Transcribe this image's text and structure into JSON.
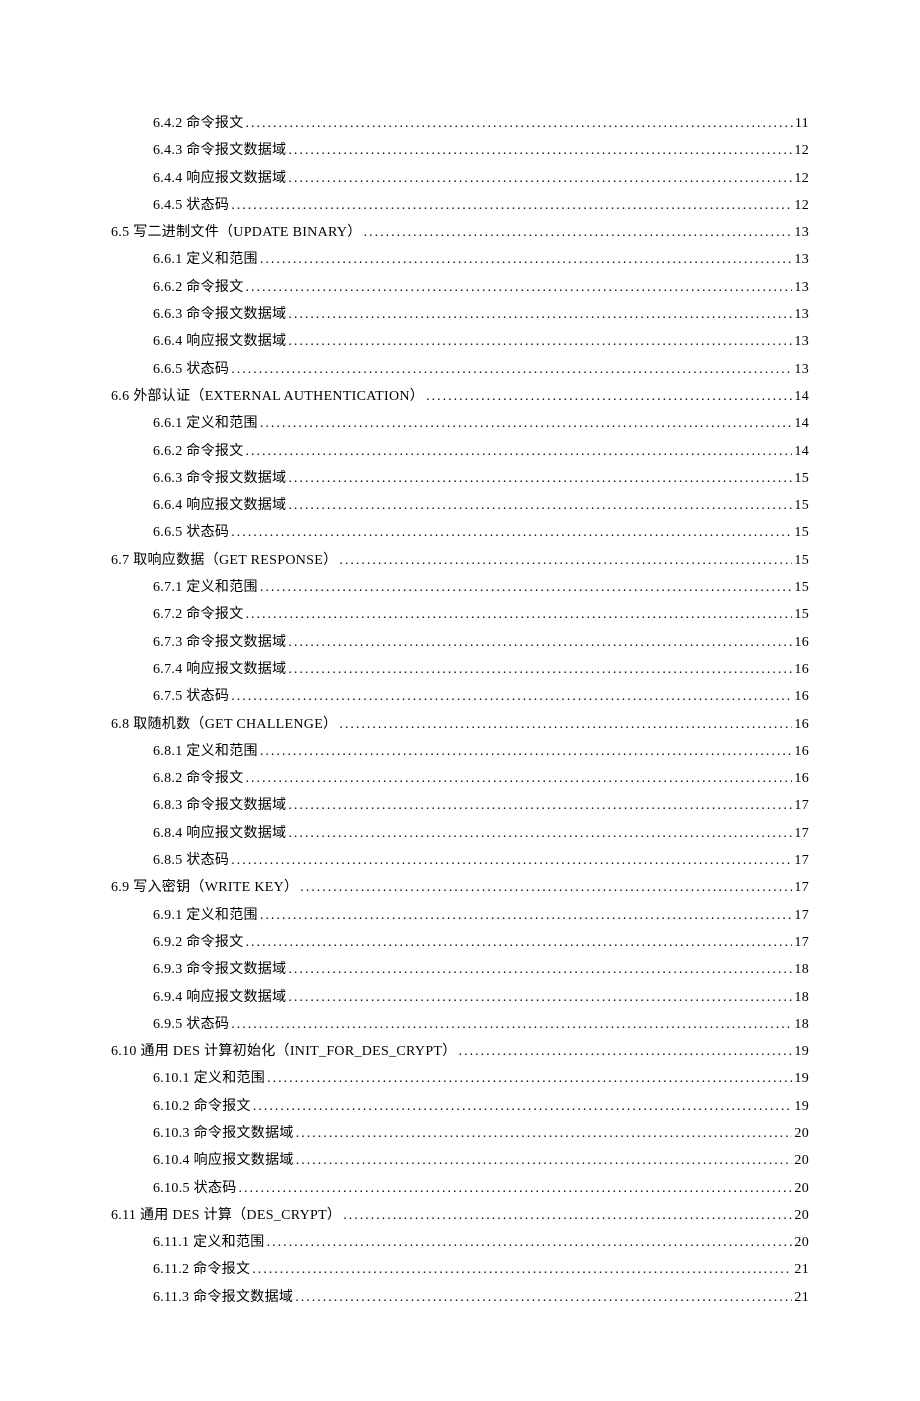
{
  "toc": [
    {
      "level": 2,
      "label": "6.4.2  命令报文",
      "page": "11"
    },
    {
      "level": 2,
      "label": "6.4.3  命令报文数据域",
      "page": "12"
    },
    {
      "level": 2,
      "label": "6.4.4  响应报文数据域",
      "page": "12"
    },
    {
      "level": 2,
      "label": "6.4.5  状态码",
      "page": "12"
    },
    {
      "level": 1,
      "label": "6.5  写二进制文件（UPDATE BINARY）",
      "page": "13"
    },
    {
      "level": 2,
      "label": "6.6.1  定义和范围",
      "page": "13"
    },
    {
      "level": 2,
      "label": "6.6.2  命令报文",
      "page": "13"
    },
    {
      "level": 2,
      "label": "6.6.3  命令报文数据域",
      "page": "13"
    },
    {
      "level": 2,
      "label": "6.6.4  响应报文数据域",
      "page": "13"
    },
    {
      "level": 2,
      "label": "6.6.5  状态码",
      "page": "13"
    },
    {
      "level": 1,
      "label": "6.6  外部认证（EXTERNAL AUTHENTICATION）",
      "page": "14"
    },
    {
      "level": 2,
      "label": "6.6.1  定义和范围",
      "page": "14"
    },
    {
      "level": 2,
      "label": "6.6.2  命令报文",
      "page": "14"
    },
    {
      "level": 2,
      "label": "6.6.3  命令报文数据域",
      "page": "15"
    },
    {
      "level": 2,
      "label": "6.6.4  响应报文数据域",
      "page": "15"
    },
    {
      "level": 2,
      "label": "6.6.5  状态码",
      "page": "15"
    },
    {
      "level": 1,
      "label": "6.7  取响应数据（GET RESPONSE）",
      "page": "15"
    },
    {
      "level": 2,
      "label": "6.7.1  定义和范围",
      "page": "15"
    },
    {
      "level": 2,
      "label": "6.7.2  命令报文",
      "page": "15"
    },
    {
      "level": 2,
      "label": "6.7.3  命令报文数据域",
      "page": "16"
    },
    {
      "level": 2,
      "label": "6.7.4  响应报文数据域",
      "page": "16"
    },
    {
      "level": 2,
      "label": "6.7.5  状态码",
      "page": "16"
    },
    {
      "level": 1,
      "label": "6.8  取随机数（GET CHALLENGE）",
      "page": "16"
    },
    {
      "level": 2,
      "label": "6.8.1  定义和范围",
      "page": "16"
    },
    {
      "level": 2,
      "label": "6.8.2  命令报文",
      "page": "16"
    },
    {
      "level": 2,
      "label": "6.8.3  命令报文数据域",
      "page": "17"
    },
    {
      "level": 2,
      "label": "6.8.4  响应报文数据域",
      "page": "17"
    },
    {
      "level": 2,
      "label": "6.8.5  状态码",
      "page": "17"
    },
    {
      "level": 1,
      "label": "6.9  写入密钥（WRITE KEY）",
      "page": "17"
    },
    {
      "level": 2,
      "label": "6.9.1  定义和范围",
      "page": "17"
    },
    {
      "level": 2,
      "label": "6.9.2  命令报文",
      "page": "17"
    },
    {
      "level": 2,
      "label": "6.9.3  命令报文数据域",
      "page": "18"
    },
    {
      "level": 2,
      "label": "6.9.4  响应报文数据域",
      "page": "18"
    },
    {
      "level": 2,
      "label": "6.9.5  状态码",
      "page": "18"
    },
    {
      "level": 1,
      "label": "6.10  通用 DES 计算初始化（INIT_FOR_DES_CRYPT）",
      "page": "19"
    },
    {
      "level": 2,
      "label": "6.10.1  定义和范围",
      "page": "19"
    },
    {
      "level": 2,
      "label": "6.10.2  命令报文",
      "page": "19"
    },
    {
      "level": 2,
      "label": "6.10.3  命令报文数据域",
      "page": "20"
    },
    {
      "level": 2,
      "label": "6.10.4  响应报文数据域",
      "page": "20"
    },
    {
      "level": 2,
      "label": "6.10.5  状态码",
      "page": "20"
    },
    {
      "level": 1,
      "label": "6.11  通用 DES 计算（DES_CRYPT）",
      "page": "20"
    },
    {
      "level": 2,
      "label": "6.11.1  定义和范围",
      "page": "20"
    },
    {
      "level": 2,
      "label": "6.11.2  命令报文",
      "page": "21"
    },
    {
      "level": 2,
      "label": "6.11.3  命令报文数据域",
      "page": "21"
    }
  ]
}
